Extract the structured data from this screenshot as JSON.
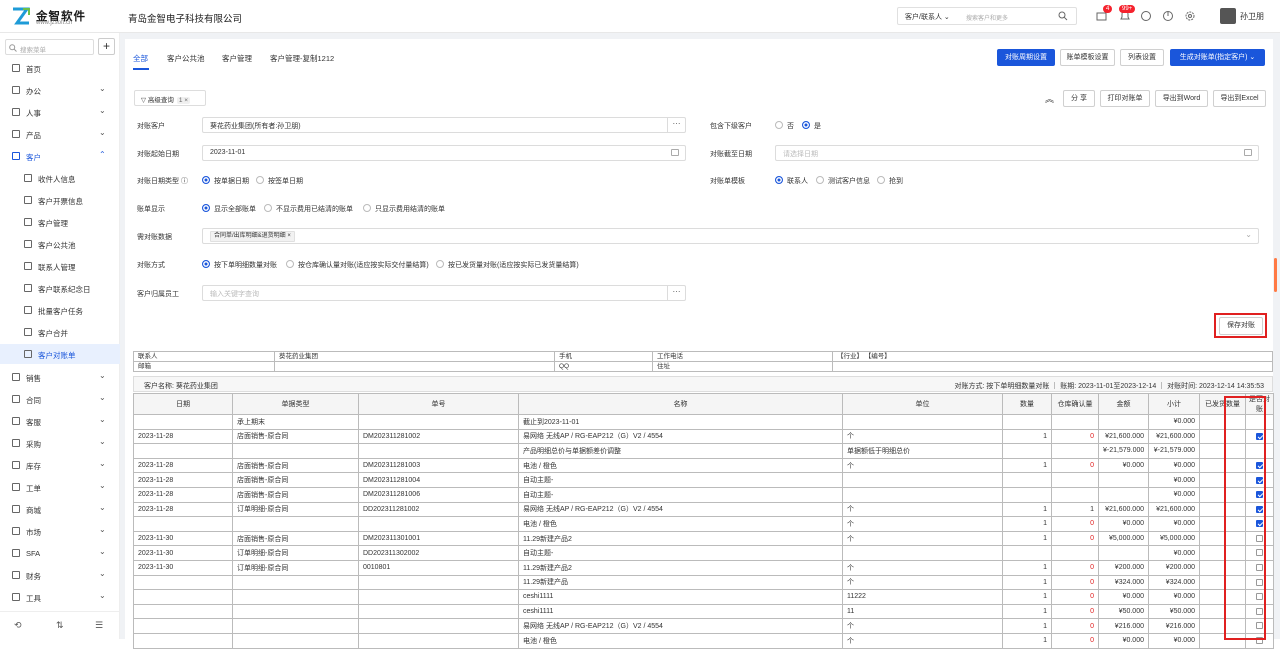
{
  "header": {
    "logo_name": "金智软件",
    "logo_url": "www.jzsoft.cn",
    "company": "青岛金智电子科技有限公司",
    "search_scope": "客户/联系人",
    "search_placeholder": "搜索客户和更多",
    "badge_msg": "4",
    "badge_notice": "99+",
    "user_name": "孙卫朋"
  },
  "sidebar": {
    "search_placeholder": "搜索菜单",
    "items": [
      {
        "label": "首页",
        "type": "top"
      },
      {
        "label": "办公",
        "type": "top",
        "arrow": "⌄"
      },
      {
        "label": "人事",
        "type": "top",
        "arrow": "⌄"
      },
      {
        "label": "产品",
        "type": "top",
        "arrow": "⌄"
      },
      {
        "label": "客户",
        "type": "open",
        "arrow": "⌃"
      },
      {
        "label": "收件人信息",
        "type": "sub"
      },
      {
        "label": "客户开票信息",
        "type": "sub"
      },
      {
        "label": "客户管理",
        "type": "sub"
      },
      {
        "label": "客户公共池",
        "type": "sub"
      },
      {
        "label": "联系人管理",
        "type": "sub"
      },
      {
        "label": "客户联系纪念日",
        "type": "sub"
      },
      {
        "label": "批量客户任务",
        "type": "sub"
      },
      {
        "label": "客户合并",
        "type": "sub"
      },
      {
        "label": "客户对账单",
        "type": "active"
      },
      {
        "label": "销售",
        "type": "top",
        "arrow": "⌄"
      },
      {
        "label": "合同",
        "type": "top",
        "arrow": "⌄"
      },
      {
        "label": "客服",
        "type": "top",
        "arrow": "⌄"
      },
      {
        "label": "采购",
        "type": "top",
        "arrow": "⌄"
      },
      {
        "label": "库存",
        "type": "top",
        "arrow": "⌄"
      },
      {
        "label": "工单",
        "type": "top",
        "arrow": "⌄"
      },
      {
        "label": "商城",
        "type": "top",
        "arrow": "⌄"
      },
      {
        "label": "市场",
        "type": "top",
        "arrow": "⌄"
      },
      {
        "label": "SFA",
        "type": "top",
        "arrow": "⌄"
      },
      {
        "label": "财务",
        "type": "top",
        "arrow": "⌄"
      },
      {
        "label": "工具",
        "type": "top",
        "arrow": "⌄"
      }
    ]
  },
  "tabs": [
    "全部",
    "客户公共池",
    "客户管理",
    "客户管理-复制1212"
  ],
  "toolbar": {
    "period": "对账周期设置",
    "template": "账单模板设置",
    "columns": "列表设置",
    "generate": "生成对账单(指定客户)",
    "share": "分 享",
    "print": "打印对账单",
    "word": "导出到Word",
    "excel": "导出到Excel",
    "filter": "高级查询",
    "filter_count": "1",
    "save": "保存对账"
  },
  "form": {
    "customer_label": "对账客户",
    "customer_value": "葵花药业集团(所有者:孙卫朋)",
    "include_label": "包含下级客户",
    "include_no": "否",
    "include_yes": "是",
    "start_label": "对账起始日期",
    "start_value": "2023-11-01",
    "end_label": "对账截至日期",
    "end_placeholder": "请选择日期",
    "datetype_label": "对账日期类型",
    "datetype_a": "按单据日期",
    "datetype_b": "按签单日期",
    "tpl_label": "对账单模板",
    "tpl_a": "联系人",
    "tpl_b": "测试客户信息",
    "tpl_c": "抢到",
    "display_label": "账单显示",
    "display_a": "显示全部账单",
    "display_b": "不显示费用已结清的账单",
    "display_c": "只显示费用结清的账单",
    "data_label": "需对账数据",
    "data_tag": "合同单/出库明细&退货明细",
    "method_label": "对账方式",
    "method_a": "按下单明细数量对账",
    "method_b": "按仓库确认量对账(适应按实际交付量结算)",
    "method_c": "按已发货量对账(适应按实际已发货量结算)",
    "staff_label": "客户归属员工",
    "staff_placeholder": "输入关键字查询"
  },
  "info": {
    "contact_l": "联系人",
    "contact_v": "葵花药业集团",
    "mobile": "手机",
    "workphone": "工作电话",
    "industry": "【行业】 【编号】",
    "email": "邮箱",
    "qq": "QQ",
    "addr": "住址"
  },
  "summary": {
    "left": "客户名称: 葵花药业集团",
    "right": "对账方式: 按下单明细数量对账 ｜ 账期: 2023-11-01至2023-12-14 ｜ 对账时间: 2023-12-14 14:35:53"
  },
  "table": {
    "headers": [
      "日期",
      "单据类型",
      "单号",
      "名称",
      "单位",
      "数量",
      "仓库确认量",
      "金额",
      "小计",
      "已发货数量",
      "是否对账"
    ],
    "rows": [
      [
        "",
        "承上期末",
        "",
        "截止到2023-11-01",
        "",
        "",
        "",
        "",
        "¥0.000",
        "",
        ""
      ],
      [
        "2023-11-28",
        "店面销售-原合同",
        "DM202311281002",
        "易网络 无线AP / RG-EAP212（G）V2 / 4554",
        "个",
        "1",
        "0",
        "¥21,600.000",
        "¥21,600.000",
        "",
        "on"
      ],
      [
        "",
        "",
        "",
        "产品明细总价与单据额差价调整",
        "单据额低于明细总价",
        "",
        "",
        "¥-21,579.000",
        "¥-21,579.000",
        "",
        ""
      ],
      [
        "2023-11-28",
        "店面销售-原合同",
        "DM202311281003",
        "电池 / 橙色",
        "个",
        "1",
        "0",
        "¥0.000",
        "¥0.000",
        "",
        "on"
      ],
      [
        "2023-11-28",
        "店面销售-原合同",
        "DM202311281004",
        "自动主题-",
        "",
        "",
        "",
        "",
        "¥0.000",
        "",
        "on"
      ],
      [
        "2023-11-28",
        "店面销售-原合同",
        "DM202311281006",
        "自动主题-",
        "",
        "",
        "",
        "",
        "¥0.000",
        "",
        "on"
      ],
      [
        "2023-11-28",
        "订单明细-原合同",
        "DD202311281002",
        "易网络 无线AP / RG-EAP212（G）V2 / 4554",
        "个",
        "1",
        "1",
        "¥21,600.000",
        "¥21,600.000",
        "",
        "on"
      ],
      [
        "",
        "",
        "",
        "电池 / 橙色",
        "个",
        "1",
        "0",
        "¥0.000",
        "¥0.000",
        "",
        "on"
      ],
      [
        "2023-11-30",
        "店面销售-原合同",
        "DM202311301001",
        "11.29新建产品2",
        "个",
        "1",
        "0",
        "¥5,000.000",
        "¥5,000.000",
        "",
        "off"
      ],
      [
        "2023-11-30",
        "订单明细-原合同",
        "DD202311302002",
        "自动主题-",
        "",
        "",
        "",
        "",
        "¥0.000",
        "",
        "off"
      ],
      [
        "2023-11-30",
        "订单明细-原合同",
        "0010801",
        "11.29新建产品2",
        "个",
        "1",
        "0",
        "¥200.000",
        "¥200.000",
        "",
        "off"
      ],
      [
        "",
        "",
        "",
        "11.29新建产品",
        "个",
        "1",
        "0",
        "¥324.000",
        "¥324.000",
        "",
        "off"
      ],
      [
        "",
        "",
        "",
        "ceshi1111",
        "11222",
        "1",
        "0",
        "¥0.000",
        "¥0.000",
        "",
        "off"
      ],
      [
        "",
        "",
        "",
        "ceshi1111",
        "11",
        "1",
        "0",
        "¥50.000",
        "¥50.000",
        "",
        "off"
      ],
      [
        "",
        "",
        "",
        "易网络 无线AP / RG-EAP212（G）V2 / 4554",
        "个",
        "1",
        "0",
        "¥216.000",
        "¥216.000",
        "",
        "off"
      ],
      [
        "",
        "",
        "",
        "电池 / 橙色",
        "个",
        "1",
        "0",
        "¥0.000",
        "¥0.000",
        "",
        "off"
      ]
    ]
  }
}
